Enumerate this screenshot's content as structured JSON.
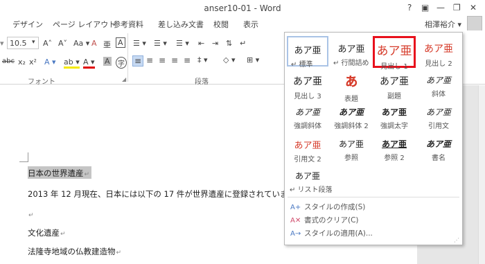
{
  "window": {
    "title": "anser10-01 - Word",
    "help": "?",
    "minimize": "—",
    "restore": "❐",
    "close": "✕"
  },
  "tabs": [
    "デザイン",
    "ページ レイアウト",
    "参考資料",
    "差し込み文書",
    "校閲",
    "表示"
  ],
  "user": {
    "name": "相澤裕介 ▾"
  },
  "ribbon": {
    "font_size": "10.5",
    "font_label": "フォント",
    "paragraph_label": "段落",
    "font_grow": "A˄",
    "font_shrink": "A˅",
    "change_case": "Aa ▾",
    "clear_format": "A",
    "phonetic": "亜",
    "char_border": "A",
    "strike": "abc",
    "subscript": "x₂",
    "superscript": "x²",
    "text_effect": "A ▾",
    "highlight": "ab ▾",
    "font_color": "A ▾",
    "char_shading": "A",
    "enclose": "字",
    "bullets": "☰ ▾",
    "numbering": "☰ ▾",
    "multilevel": "☰ ▾",
    "decrease_indent": "⇤",
    "increase_indent": "⇥",
    "sort": "⇅",
    "show_marks": "↵",
    "align_left": "≡",
    "align_center": "≡",
    "align_right": "≡",
    "justify": "≡",
    "distribute": "≡",
    "line_spacing": "‡ ▾",
    "shading": "◇ ▾",
    "borders": "⊞ ▾"
  },
  "gallery": {
    "styles": [
      {
        "sample": "あア亜",
        "label": "↵ 標準"
      },
      {
        "sample": "あア亜",
        "label": "↵ 行間詰め"
      },
      {
        "sample": "あア亜",
        "label": "見出し 1"
      },
      {
        "sample": "あア亜",
        "label": "見出し 2"
      },
      {
        "sample": "あア亜",
        "label": "見出し 3"
      },
      {
        "sample": "ぁ",
        "label": "表題"
      },
      {
        "sample": "あア亜",
        "label": "副題"
      },
      {
        "sample": "あア亜",
        "label": "斜体"
      },
      {
        "sample": "あア亜",
        "label": "強調斜体"
      },
      {
        "sample": "あア亜",
        "label": "強調斜体 2"
      },
      {
        "sample": "あア亜",
        "label": "強調太字"
      },
      {
        "sample": "あア亜",
        "label": "引用文"
      },
      {
        "sample": "あア亜",
        "label": "引用文 2"
      },
      {
        "sample": "あア亜",
        "label": "参照"
      },
      {
        "sample": "あア亜",
        "label": "参照 2"
      },
      {
        "sample": "あア亜",
        "label": "書名"
      },
      {
        "sample": "あア亜",
        "label": "↵ リスト段落"
      }
    ],
    "menu": [
      {
        "icon": "A+",
        "label": "スタイルの作成(S)"
      },
      {
        "icon": "A✕",
        "label": "書式のクリア(C)"
      },
      {
        "icon": "A→",
        "label": "スタイルの適用(A)..."
      }
    ],
    "grip": "⋰"
  },
  "document": {
    "lines": [
      "日本の世界遺産",
      "2013 年 12 月現在、日本には以下の 17 件が世界遺産に登録されていま",
      "",
      "文化遺産",
      "法隆寺地域の仏教建造物"
    ],
    "mark": "↵"
  },
  "colors": {
    "heading_red": "#d63b2a",
    "highlight_frame": "#e8101c",
    "normal_frame": "#a9c3e6",
    "selection": "#c5c5c5"
  }
}
